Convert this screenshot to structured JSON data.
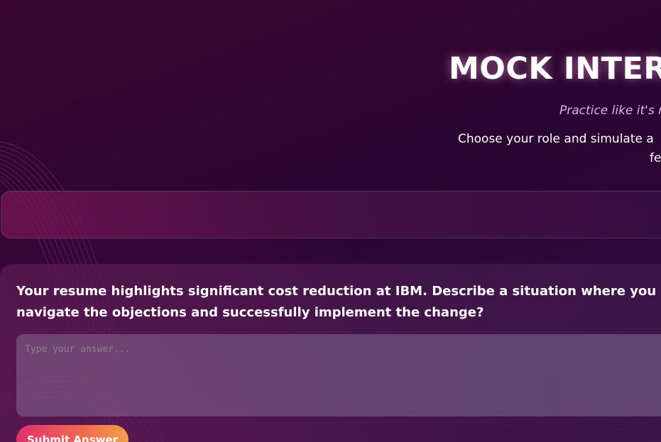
{
  "header": {
    "title": "MOCK INTERV",
    "tagline": "Practice like it's r",
    "intro_line1": "Choose your role and simulate a",
    "intro_line2": "fe"
  },
  "role_selector": {
    "value": ""
  },
  "interview": {
    "question_line1": "Your resume highlights significant cost reduction at IBM. Describe a situation where you ha",
    "question_line2": "navigate the objections and successfully implement the change?",
    "answer_placeholder": "Type your answer...",
    "answer_value": "",
    "submit_label": "Submit Answer"
  },
  "colors": {
    "background": "#2a0531",
    "tagline": "#d9b2f3",
    "submit_start": "#e0306a",
    "submit_end": "#f4a04a"
  }
}
